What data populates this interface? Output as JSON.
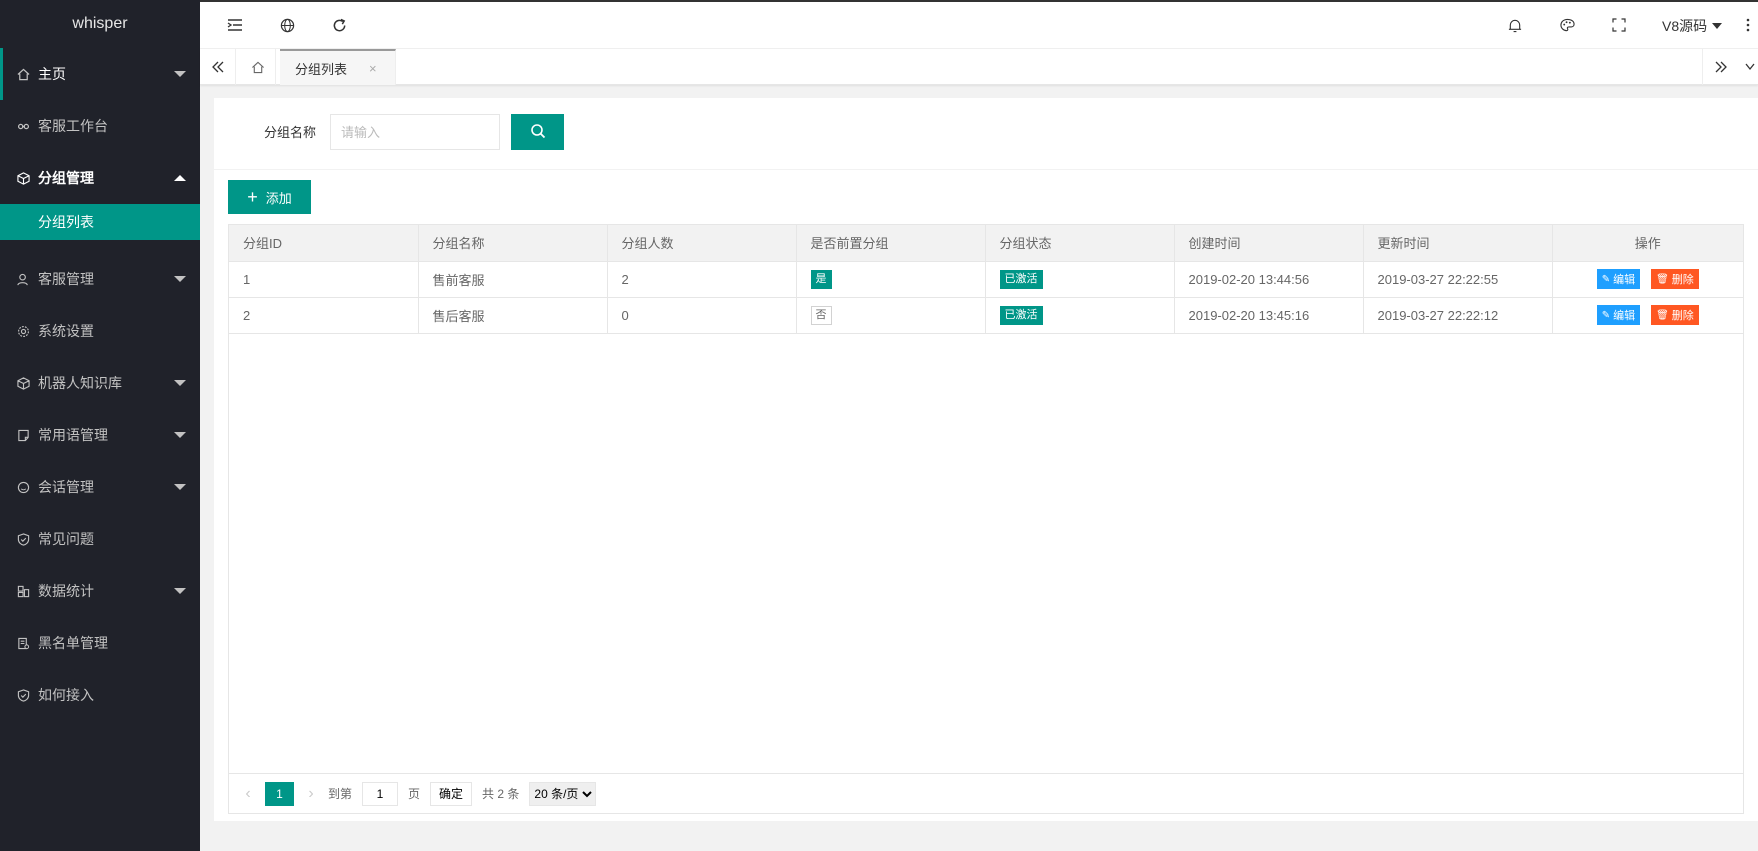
{
  "app": {
    "logo": "whisper"
  },
  "sidebar": {
    "items": [
      {
        "label": "主页",
        "icon": "home-icon",
        "has_caret": true
      },
      {
        "label": "客服工作台",
        "icon": "link-icon",
        "has_caret": false
      },
      {
        "label": "分组管理",
        "icon": "cube-icon",
        "has_caret": true,
        "expanded": true
      },
      {
        "label": "客服管理",
        "icon": "user-icon",
        "has_caret": true
      },
      {
        "label": "系统设置",
        "icon": "gear-icon",
        "has_caret": false
      },
      {
        "label": "机器人知识库",
        "icon": "cube-icon",
        "has_caret": true
      },
      {
        "label": "常用语管理",
        "icon": "note-icon",
        "has_caret": true
      },
      {
        "label": "会话管理",
        "icon": "chat-icon",
        "has_caret": true
      },
      {
        "label": "常见问题",
        "icon": "shield-icon",
        "has_caret": false
      },
      {
        "label": "数据统计",
        "icon": "chart-icon",
        "has_caret": true
      },
      {
        "label": "黑名单管理",
        "icon": "blacklist-icon",
        "has_caret": false
      },
      {
        "label": "如何接入",
        "icon": "shield-icon",
        "has_caret": false
      }
    ],
    "sub_active": "分组列表"
  },
  "header": {
    "user": "V8源码"
  },
  "tabs": {
    "current": "分组列表",
    "close": "×"
  },
  "search": {
    "label": "分组名称",
    "placeholder": "请输入"
  },
  "toolbar": {
    "add_label": "添加"
  },
  "table": {
    "columns": [
      "分组ID",
      "分组名称",
      "分组人数",
      "是否前置分组",
      "分组状态",
      "创建时间",
      "更新时间",
      "操作"
    ],
    "rows": [
      {
        "id": "1",
        "name": "售前客服",
        "count": "2",
        "front": "是",
        "front_flag": true,
        "status": "已激活",
        "created": "2019-02-20 13:44:56",
        "updated": "2019-03-27 22:22:55"
      },
      {
        "id": "2",
        "name": "售后客服",
        "count": "0",
        "front": "否",
        "front_flag": false,
        "status": "已激活",
        "created": "2019-02-20 13:45:16",
        "updated": "2019-03-27 22:22:12"
      }
    ],
    "edit_label": "编辑",
    "delete_label": "删除"
  },
  "pager": {
    "current_page": "1",
    "goto_prefix": "到第",
    "goto_value": "1",
    "goto_suffix": "页",
    "confirm": "确定",
    "total": "共 2 条",
    "page_size": "20 条/页"
  },
  "colors": {
    "sidebar_bg": "#20222a",
    "accent": "#009688",
    "edit_blue": "#1e9fff",
    "delete_orange": "#ff5722"
  }
}
